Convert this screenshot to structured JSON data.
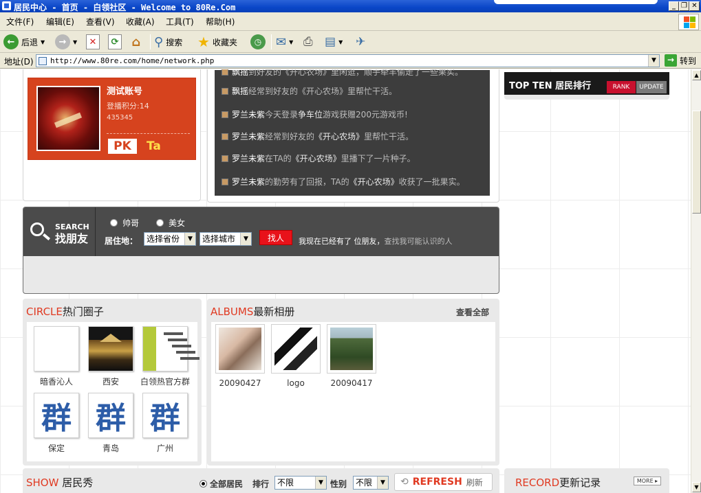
{
  "window": {
    "title": "居民中心 - 首页 - 白领社区 - Welcome to 80Re.Com"
  },
  "menu": [
    "文件(F)",
    "编辑(E)",
    "查看(V)",
    "收藏(A)",
    "工具(T)",
    "帮助(H)"
  ],
  "toolbar": {
    "back": "后退",
    "search": "搜索",
    "favorites": "收藏夹"
  },
  "address": {
    "label": "地址(D)",
    "url": "http://www.80re.com/home/network.php",
    "go": "转到"
  },
  "profile": {
    "name": "测试账号",
    "score": "登播积分:14",
    "number": "435345",
    "pk": "PK",
    "ta": "Ta"
  },
  "feed": [
    {
      "name": "飘摇",
      "parts": [
        {
          "t": "到好友的《开心农场》里闲逛，顺手牵羊偷走了一些果实。",
          "h": false
        }
      ]
    },
    {
      "name": "飘摇",
      "parts": [
        {
          "t": "经常到好友的《开心农场》里帮忙干活。",
          "h": false
        }
      ]
    },
    {
      "name": "罗兰未紫",
      "parts": [
        {
          "t": " 今天登录",
          "h": false
        },
        {
          "t": "争车位",
          "h": true
        },
        {
          "t": "游戏获赠200元游戏币!",
          "h": false
        }
      ]
    },
    {
      "name": "罗兰未紫",
      "parts": [
        {
          "t": "经常到好友的",
          "h": false
        },
        {
          "t": "《开心农场》",
          "h": true
        },
        {
          "t": "里帮忙干活。",
          "h": false
        }
      ]
    },
    {
      "name": "罗兰未紫",
      "parts": [
        {
          "t": "在TA的",
          "h": false
        },
        {
          "t": "《开心农场》",
          "h": true
        },
        {
          "t": "里播下了一片种子。",
          "h": false
        }
      ]
    },
    {
      "name": "罗兰未紫",
      "parts": [
        {
          "t": "的勤劳有了回报，TA的",
          "h": false
        },
        {
          "t": "《开心农场》",
          "h": true
        },
        {
          "t": "收获了一批果实。",
          "h": false
        }
      ]
    }
  ],
  "search": {
    "en": "SEARCH",
    "zh": "找朋友",
    "gender_male": "帅哥",
    "gender_female": "美女",
    "residence_label": "居住地：",
    "province": "选择省份",
    "city": "选择城市",
    "find": "找人",
    "friends_text": "我现在已经有了  位朋友，",
    "friends_link": "查找我可能认识的人"
  },
  "top_ten": {
    "title": "TOP TEN 居民排行",
    "rank": "RANK",
    "update": "UPDATE"
  },
  "circle": {
    "en": "CIRCLE",
    "zh": "热门圈子",
    "items": [
      {
        "name": "暗香沁人",
        "icon": "blank-thumbnail"
      },
      {
        "name": "西安",
        "icon": "xian-tower-photo"
      },
      {
        "name": "白领热官方群",
        "icon": "logo-thumbnail"
      },
      {
        "name": "保定",
        "icon": "qun-icon"
      },
      {
        "name": "青岛",
        "icon": "qun-icon"
      },
      {
        "name": "广州",
        "icon": "qun-icon"
      }
    ],
    "qun_glyph": "群"
  },
  "albums": {
    "en": "ALBUMS",
    "zh": "最新相册",
    "view_all": "查看全部",
    "items": [
      {
        "name": "20090427"
      },
      {
        "name": "logo"
      },
      {
        "name": "20090417"
      }
    ]
  },
  "show": {
    "en": "SHOW",
    "zh": "居民秀",
    "all": "全部居民",
    "rank_label": "排行",
    "rank_value": "不限",
    "gender_label": "性别",
    "gender_value": "不限",
    "refresh_en": "REFRESH",
    "refresh_zh": "刷新"
  },
  "record": {
    "en": "RECORD",
    "zh": "更新记录",
    "more": "MORE"
  },
  "colors": {
    "accent": "#e03a22",
    "title_bar": "#0a46c8",
    "find_button": "#e8121a"
  }
}
